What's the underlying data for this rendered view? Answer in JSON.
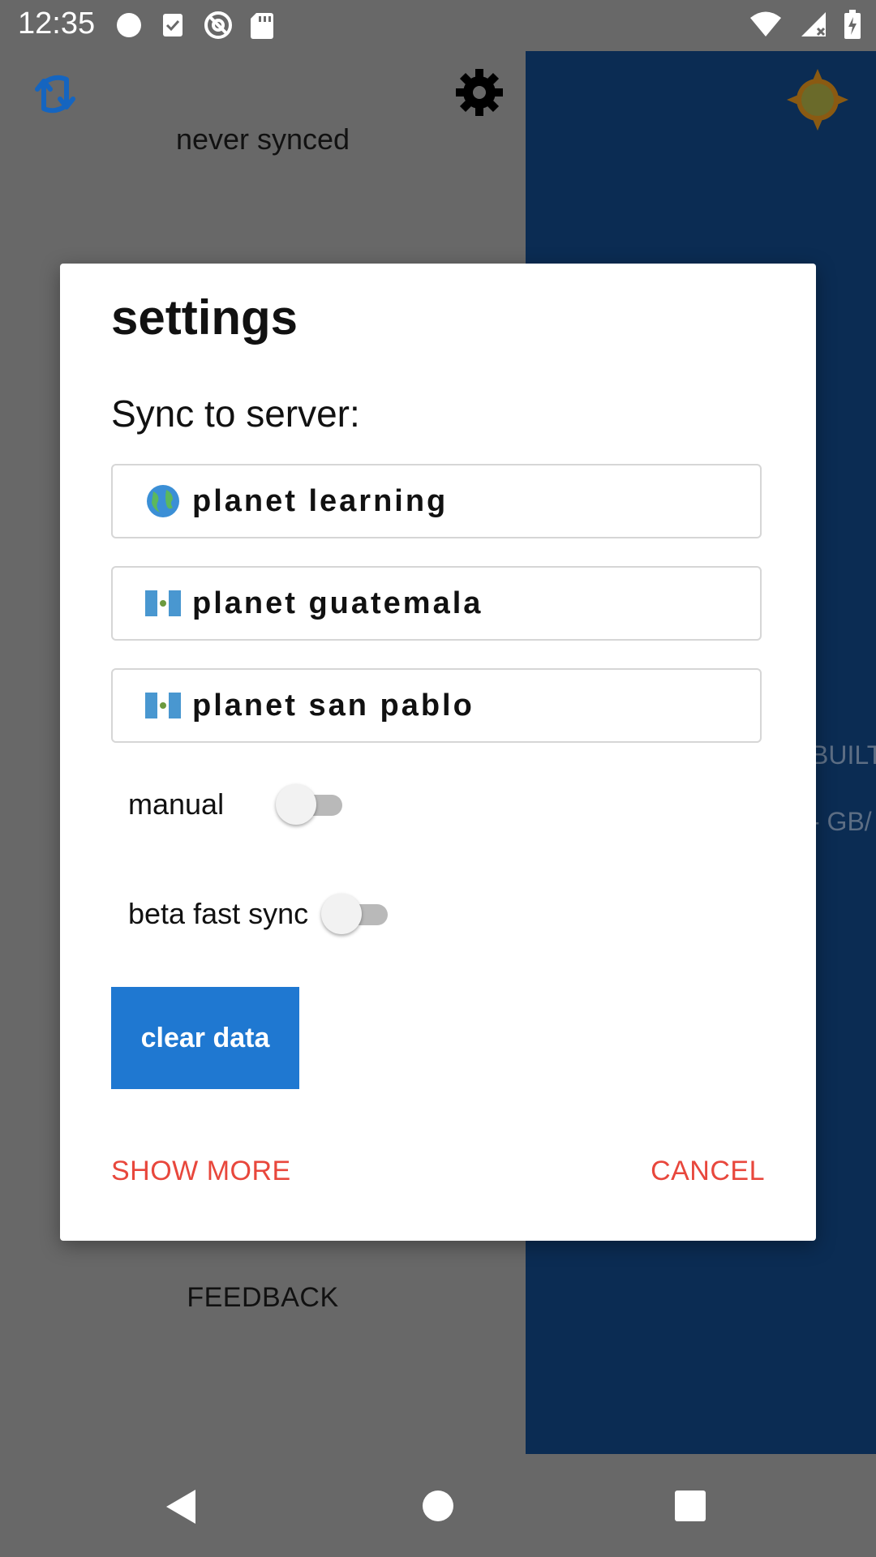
{
  "status_bar": {
    "time": "12:35"
  },
  "app": {
    "sync_status": "never synced",
    "feedback_label": "FEEDBACK",
    "peek_text_1": "BUILT",
    "peek_text_2": "- GB/"
  },
  "dialog": {
    "title": "settings",
    "sync_label": "Sync to server:",
    "servers": [
      {
        "flag": "🌎",
        "label": "planet learning"
      },
      {
        "flag": "GT",
        "label": "planet guatemala"
      },
      {
        "flag": "GT",
        "label": "planet san pablo"
      }
    ],
    "toggles": [
      {
        "label": "manual",
        "on": false
      },
      {
        "label": "beta fast sync",
        "on": false
      }
    ],
    "clear_button": "clear data",
    "show_more": "SHOW MORE",
    "cancel": "CANCEL"
  },
  "colors": {
    "accent": "#1f78d1",
    "action_text": "#e8473c",
    "right_panel": "#0b2c53",
    "background": "#686868"
  }
}
